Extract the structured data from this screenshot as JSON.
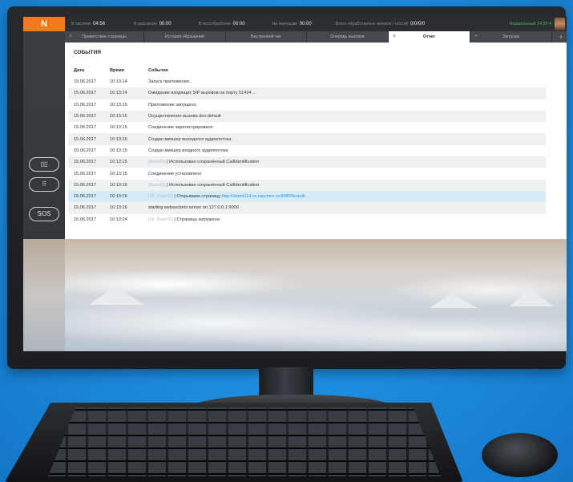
{
  "brand": {
    "logo": "N",
    "accent": "#f07a1e"
  },
  "topbar": {
    "stats": [
      {
        "label": "В системе",
        "value": "04:56"
      },
      {
        "label": "В разговоре",
        "value": "00:00"
      },
      {
        "label": "В постобработке",
        "value": "00:00"
      },
      {
        "label": "На перерыве",
        "value": "00:00"
      },
      {
        "label": "Всего обработанных звонков / сессий",
        "value": "0/0/0/0"
      }
    ],
    "status": "Нормальный 14:55 ▾",
    "status_color": "#37c25a"
  },
  "tabs": [
    {
      "label": "Приветствие страницы",
      "closable": true,
      "active": false
    },
    {
      "label": "История обращений",
      "closable": false,
      "active": false
    },
    {
      "label": "Внутренний чат",
      "closable": false,
      "active": false
    },
    {
      "label": "Очередь вызовов",
      "closable": false,
      "active": false
    },
    {
      "label": "Отчет",
      "closable": true,
      "active": true
    },
    {
      "label": "Загрузка",
      "closable": true,
      "active": false
    }
  ],
  "sidebar": {
    "buttons": [
      {
        "icon": "book-icon",
        "label": "▯▯"
      },
      {
        "icon": "dialpad-icon",
        "label": "⠿"
      },
      {
        "icon": "sos-icon",
        "label": "SOS"
      }
    ]
  },
  "events": {
    "title": "СОБЫТИЯ",
    "columns": [
      "Дата",
      "Время",
      "Событие"
    ],
    "rows": [
      {
        "date": "15.06.2017",
        "time": "10:13:14",
        "prefix": "",
        "text": "Запуск приложения...",
        "link": "",
        "highlight": false
      },
      {
        "date": "15.06.2017",
        "time": "10:13:14",
        "prefix": "",
        "text": "Ожидание входящих SIP вызовов на порту 51424 ...",
        "link": "",
        "highlight": false
      },
      {
        "date": "15.06.2017",
        "time": "10:13:15",
        "prefix": "",
        "text": "Приложение запущено",
        "link": "",
        "highlight": false
      },
      {
        "date": "15.06.2017",
        "time": "10:13:15",
        "prefix": "",
        "text": "Осуществление вызова dev:default",
        "link": "",
        "highlight": false
      },
      {
        "date": "15.06.2017",
        "time": "10:13:15",
        "prefix": "",
        "text": "Соединение зарегистрировано",
        "link": "",
        "highlight": false
      },
      {
        "date": "15.06.2017",
        "time": "10:13:15",
        "prefix": "",
        "text": "Создан микшер выходного аудиопотока",
        "link": "",
        "highlight": false
      },
      {
        "date": "15.06.2017",
        "time": "10:13:15",
        "prefix": "",
        "text": "Создан микшер входного аудиопотока",
        "link": "",
        "highlight": false
      },
      {
        "date": "15.06.2017",
        "time": "10:13:15",
        "prefix": "[BaseID]",
        "text": " | Использован сохранённый CallIdentification",
        "link": "",
        "highlight": false
      },
      {
        "date": "15.06.2017",
        "time": "10:13:15",
        "prefix": "",
        "text": "Соединение установлено",
        "link": "",
        "highlight": false
      },
      {
        "date": "15.06.2017",
        "time": "10:13:16",
        "prefix": "[BaseID]",
        "text": " | Использован сохранённый CallIdentification",
        "link": "",
        "highlight": false
      },
      {
        "date": "15.06.2017",
        "time": "10:13:16",
        "prefix": "[16, BaseID]",
        "text": " | Открываем страницу ",
        "link": "http://stand114.cc.naumen.ru:8080/fx/auth",
        "highlight": true
      },
      {
        "date": "15.06.2017",
        "time": "10:13:16",
        "prefix": "",
        "text": "starting websockets server on 127.0.0.1:9000",
        "link": "",
        "highlight": false
      },
      {
        "date": "15.06.2017",
        "time": "10:13:24",
        "prefix": "[16, BaseID]",
        "text": " | Страница загружена",
        "link": "",
        "highlight": false
      }
    ]
  }
}
